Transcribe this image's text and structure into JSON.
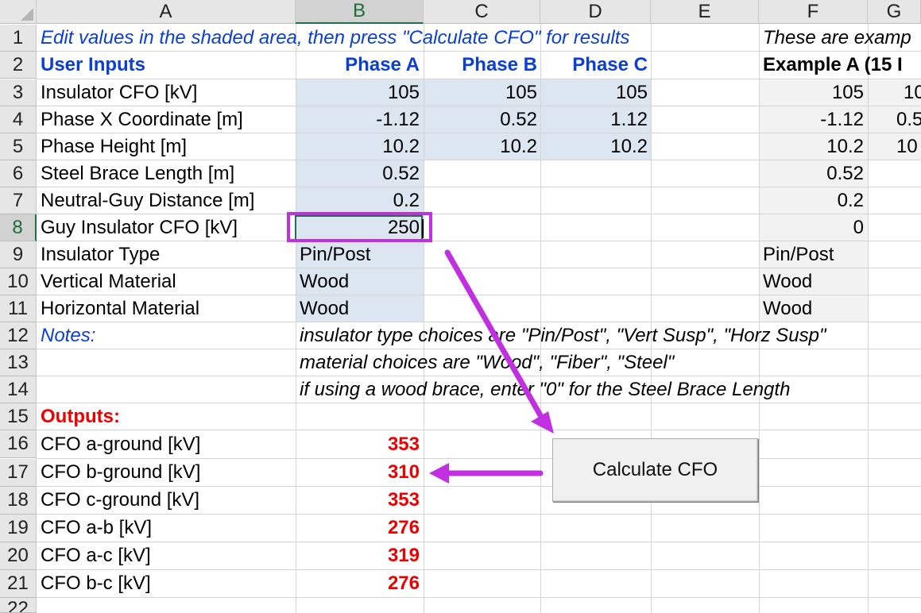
{
  "columns": [
    "A",
    "B",
    "C",
    "D",
    "E",
    "F",
    "G"
  ],
  "selected_column": "B",
  "rows": [
    "1",
    "2",
    "3",
    "4",
    "5",
    "6",
    "7",
    "8",
    "9",
    "10",
    "11",
    "12",
    "13",
    "14",
    "15",
    "16",
    "17",
    "18",
    "19",
    "20",
    "21",
    "22"
  ],
  "selected_row": "8",
  "instruction": "Edit values in the shaded area, then press \"Calculate CFO\" for results",
  "example_note": "These are examp",
  "inputs": {
    "section_label": "User Inputs",
    "phases": [
      "Phase A",
      "Phase B",
      "Phase C"
    ],
    "example_header": "Example A (15 I",
    "rows": [
      {
        "label": "Insulator CFO [kV]",
        "a": "105",
        "b": "105",
        "c": "105",
        "ex_f": "105",
        "ex_g": "10"
      },
      {
        "label": "Phase X Coordinate [m]",
        "a": "-1.12",
        "b": "0.52",
        "c": "1.12",
        "ex_f": "-1.12",
        "ex_g": "0.5"
      },
      {
        "label": "Phase Height [m]",
        "a": "10.2",
        "b": "10.2",
        "c": "10.2",
        "ex_f": "10.2",
        "ex_g": "10"
      },
      {
        "label": "Steel Brace Length [m]",
        "a": "0.52",
        "ex_f": "0.52"
      },
      {
        "label": "Neutral-Guy Distance [m]",
        "a": "0.2",
        "ex_f": "0.2"
      },
      {
        "label": "Guy Insulator CFO [kV]",
        "a": "250",
        "ex_f": "0"
      },
      {
        "label": "Insulator Type",
        "a": "Pin/Post",
        "ex_f": "Pin/Post"
      },
      {
        "label": "Vertical Material",
        "a": "Wood",
        "ex_f": "Wood"
      },
      {
        "label": "Horizontal Material",
        "a": "Wood",
        "ex_f": "Wood"
      }
    ]
  },
  "notes": {
    "label": "Notes:",
    "lines": [
      "insulator type choices are \"Pin/Post\", \"Vert Susp\", \"Horz Susp\"",
      "material choices are \"Wood\", \"Fiber\", \"Steel\"",
      "if using a wood brace, enter \"0\" for the Steel Brace Length"
    ]
  },
  "outputs": {
    "label": "Outputs:",
    "rows": [
      {
        "label": "CFO a-ground [kV]",
        "value": "353"
      },
      {
        "label": "CFO b-ground [kV]",
        "value": "310"
      },
      {
        "label": "CFO c-ground [kV]",
        "value": "353"
      },
      {
        "label": "CFO a-b [kV]",
        "value": "276"
      },
      {
        "label": "CFO a-c [kV]",
        "value": "319"
      },
      {
        "label": "CFO b-c [kV]",
        "value": "276"
      }
    ]
  },
  "button_label": "Calculate CFO",
  "colors": {
    "accent_highlight": "#c02fe0",
    "input_shading": "#dce6f1",
    "output_red": "#ee0000",
    "header_blue": "#0a3fd1",
    "excel_green": "#217346"
  }
}
